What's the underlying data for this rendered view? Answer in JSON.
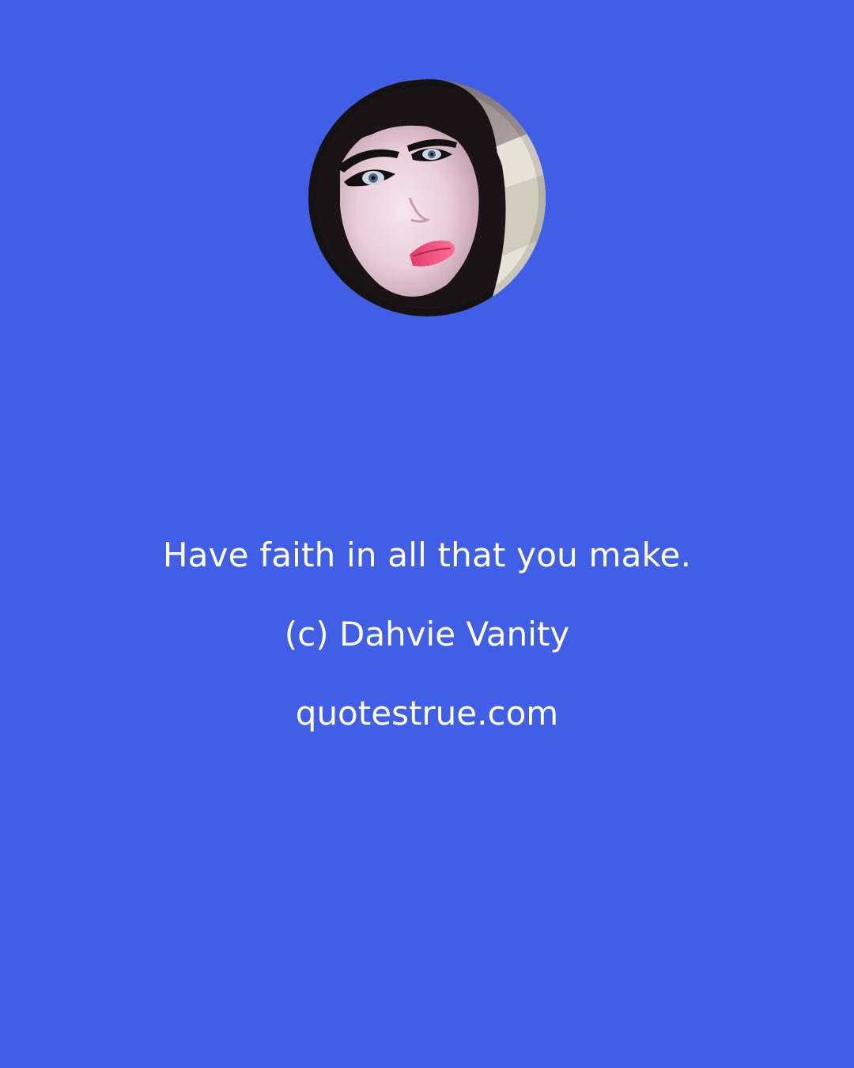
{
  "quote": {
    "text": "Have faith in all that you make.",
    "author": "(c) Dahvie Vanity",
    "site": "quotestrue.com"
  },
  "colors": {
    "background": "#405ee6",
    "text": "#ffffff"
  },
  "portrait": {
    "icon": "author-portrait-photo"
  }
}
